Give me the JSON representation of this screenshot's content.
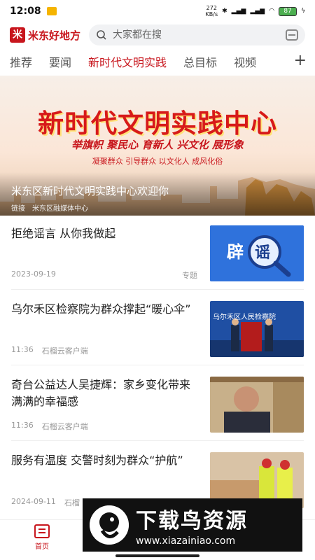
{
  "status_bar": {
    "time": "12:08",
    "speed_value": "272",
    "speed_unit": "KB/s",
    "battery": "87"
  },
  "header": {
    "app_name": "米东好地方",
    "search_placeholder": "大家都在搜"
  },
  "tabs": [
    {
      "label": "推荐"
    },
    {
      "label": "要闻"
    },
    {
      "label": "新时代文明实践",
      "active": true
    },
    {
      "label": "总目标"
    },
    {
      "label": "视频"
    }
  ],
  "tab_more": "+",
  "banner": {
    "title": "新时代文明实践中心",
    "slogan": "举旗帜 聚民心 育新人 兴文化 展形象",
    "sub_slogan": "凝聚群众 引导群众 以文化人 成风化俗",
    "caption": "米东区新时代文明实践中心欢迎你",
    "link_label": "链接",
    "source": "米东区融媒体中心"
  },
  "news": [
    {
      "title": "拒绝谣言 从你我做起",
      "date": "2023-09-19",
      "source": "",
      "tag": "专题",
      "thumb": "辟谣"
    },
    {
      "title": "乌尔禾区检察院为群众撑起“暖心伞”",
      "date": "11:36",
      "source": "石榴云客户端",
      "tag": "",
      "thumb": "乌尔禾区人民检察院"
    },
    {
      "title": "奇台公益达人吴捷辉：家乡变化带来满满的幸福感",
      "date": "11:36",
      "source": "石榴云客户端",
      "tag": "",
      "thumb": ""
    },
    {
      "title": "服务有温度 交警时刻为群众“护航”",
      "date": "2024-09-11",
      "source": "石榴",
      "tag": "",
      "thumb": ""
    }
  ],
  "bottom_nav": {
    "home_label": "首页"
  },
  "watermark": {
    "main": "下载鸟资源",
    "url": "www.xiazainiao.com"
  },
  "colors": {
    "brand_red": "#c8161d",
    "active_tab": "#c8161d"
  }
}
